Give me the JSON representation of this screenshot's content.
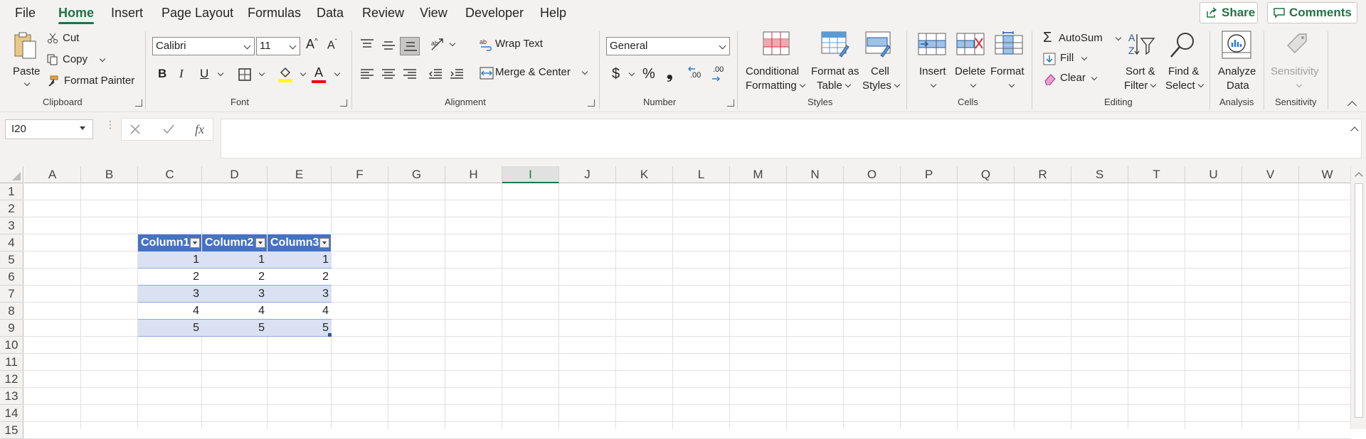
{
  "menu": {
    "items": [
      "File",
      "Home",
      "Insert",
      "Page Layout",
      "Formulas",
      "Data",
      "Review",
      "View",
      "Developer",
      "Help"
    ],
    "active": "Home",
    "share_label": "Share",
    "comments_label": "Comments"
  },
  "ribbon": {
    "clipboard": {
      "paste": "Paste",
      "cut": "Cut",
      "copy": "Copy",
      "format_painter": "Format Painter",
      "label": "Clipboard"
    },
    "font": {
      "family": "Calibri",
      "size": "11",
      "label": "Font",
      "bold": "B",
      "italic": "I",
      "underline": "U",
      "grow": "A",
      "shrink": "A",
      "font_color": "A"
    },
    "alignment": {
      "wrap_text": "Wrap Text",
      "merge_center": "Merge & Center",
      "label": "Alignment"
    },
    "number": {
      "format": "General",
      "currency": "$",
      "percent": "%",
      "comma": "❟",
      "inc_decimal": ".00",
      "dec_decimal": ".00",
      "label": "Number"
    },
    "styles": {
      "conditional_1": "Conditional",
      "conditional_2": "Formatting",
      "format_table_1": "Format as",
      "format_table_2": "Table",
      "cell_styles_1": "Cell",
      "cell_styles_2": "Styles",
      "label": "Styles"
    },
    "cells": {
      "insert": "Insert",
      "delete": "Delete",
      "format": "Format",
      "label": "Cells"
    },
    "editing": {
      "autosum": "AutoSum",
      "fill": "Fill",
      "clear": "Clear",
      "sort_1": "Sort &",
      "sort_2": "Filter",
      "find_1": "Find &",
      "find_2": "Select",
      "label": "Editing"
    },
    "analysis": {
      "analyze_1": "Analyze",
      "analyze_2": "Data",
      "label": "Analysis"
    },
    "sensitivity": {
      "button": "Sensitivity",
      "label": "Sensitivity"
    }
  },
  "formula_bar": {
    "name_box": "I20",
    "fx": "fx",
    "value": ""
  },
  "sheet": {
    "columns": [
      "A",
      "B",
      "C",
      "D",
      "E",
      "F",
      "G",
      "H",
      "I",
      "J",
      "K",
      "L",
      "M",
      "N",
      "O",
      "P",
      "Q",
      "R",
      "S",
      "T",
      "U",
      "V",
      "W"
    ],
    "selected_column": "I",
    "rows": [
      "1",
      "2",
      "3",
      "4",
      "5",
      "6",
      "7",
      "8",
      "9",
      "10",
      "11",
      "12",
      "13",
      "14",
      "15"
    ],
    "table": {
      "headers": [
        "Column1",
        "Column2",
        "Column3"
      ],
      "rows": [
        [
          "1",
          "1",
          "1"
        ],
        [
          "2",
          "2",
          "2"
        ],
        [
          "3",
          "3",
          "3"
        ],
        [
          "4",
          "4",
          "4"
        ],
        [
          "5",
          "5",
          "5"
        ]
      ]
    }
  }
}
